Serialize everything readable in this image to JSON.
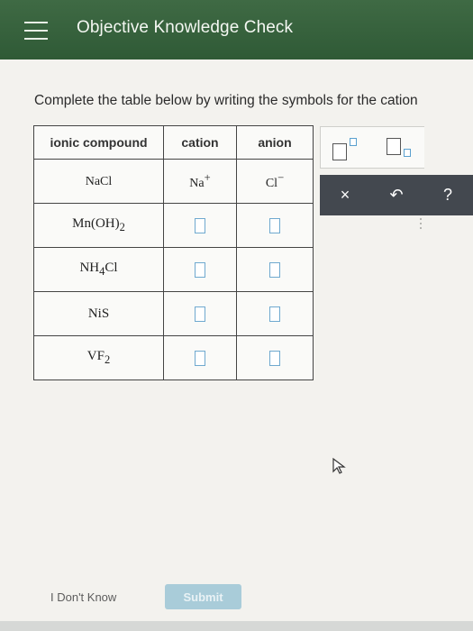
{
  "header": {
    "title": "Objective Knowledge Check"
  },
  "instruction": "Complete the table below by writing the symbols for the cation",
  "table": {
    "headers": [
      "ionic compound",
      "cation",
      "anion"
    ],
    "rows": [
      {
        "compound": "NaCl",
        "cation": "Na",
        "cation_charge": "+",
        "anion": "Cl",
        "anion_charge": "−"
      },
      {
        "compound": "Mn(OH)",
        "compound_sub": "2",
        "compound_suffix": ""
      },
      {
        "compound": "NH",
        "compound_sub": "4",
        "compound_suffix": "Cl"
      },
      {
        "compound": "NiS"
      },
      {
        "compound": "VF",
        "compound_sub": "2",
        "compound_suffix": ""
      }
    ]
  },
  "palette": {
    "clear": "×",
    "undo": "↶",
    "help": "?"
  },
  "footer": {
    "dont_know": "I Don't Know",
    "submit": "Submit"
  },
  "colors": {
    "header_bg": "#3f6a44",
    "palette_bar": "#43484f",
    "blank_border": "#6fa9cf",
    "submit_bg": "#a9ccd9"
  }
}
